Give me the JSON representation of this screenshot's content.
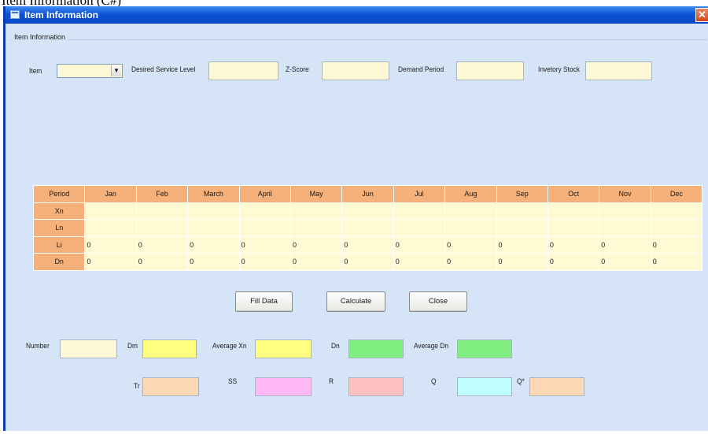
{
  "caption": "Item Information (C#)",
  "window": {
    "title": "Item Information",
    "close_glyph": "✕"
  },
  "group_label": "Item Information",
  "top_fields": {
    "item_label": "Item",
    "item_value": "",
    "service_level_label": "Desired Service Level",
    "zscore_label": "Z-Score",
    "demand_period_label": "Demand Period",
    "inventory_stock_label": "Invetory Stock"
  },
  "grid": {
    "period_label": "Period",
    "months": [
      "Jan",
      "Feb",
      "March",
      "April",
      "May",
      "Jun",
      "Jul",
      "Aug",
      "Sep",
      "Oct",
      "Nov",
      "Dec"
    ],
    "rows": [
      {
        "label": "Xn",
        "values": [
          "",
          "",
          "",
          "",
          "",
          "",
          "",
          "",
          "",
          "",
          "",
          ""
        ]
      },
      {
        "label": "Ln",
        "values": [
          "",
          "",
          "",
          "",
          "",
          "",
          "",
          "",
          "",
          "",
          "",
          ""
        ]
      },
      {
        "label": "Li",
        "values": [
          "0",
          "0",
          "0",
          "0",
          "0",
          "0",
          "0",
          "0",
          "0",
          "0",
          "0",
          "0"
        ]
      },
      {
        "label": "Dn",
        "values": [
          "0",
          "0",
          "0",
          "0",
          "0",
          "0",
          "0",
          "0",
          "0",
          "0",
          "0",
          "0"
        ]
      }
    ]
  },
  "buttons": {
    "fill_data": "Fill Data",
    "calculate": "Calculate",
    "close": "Close"
  },
  "results": {
    "number_label": "Number",
    "dm_label": "Dm",
    "avg_xn_label": "Average Xn",
    "dn_label": "Dn",
    "avg_dn_label": "Average Dn",
    "tr_label": "Tr",
    "ss_label": "SS",
    "r_label": "R",
    "q_label": "Q",
    "qstar_label": "Q*"
  },
  "colors": {
    "number": "#fff8d6",
    "dm": "#ffff80",
    "avg_xn": "#ffff80",
    "dn": "#80ee80",
    "avg_dn": "#80ee80",
    "tr": "#fcd8b4",
    "ss": "#ffb8f4",
    "r": "#ffc0c0",
    "q": "#c0ffff",
    "qstar": "#fcd8b4"
  }
}
